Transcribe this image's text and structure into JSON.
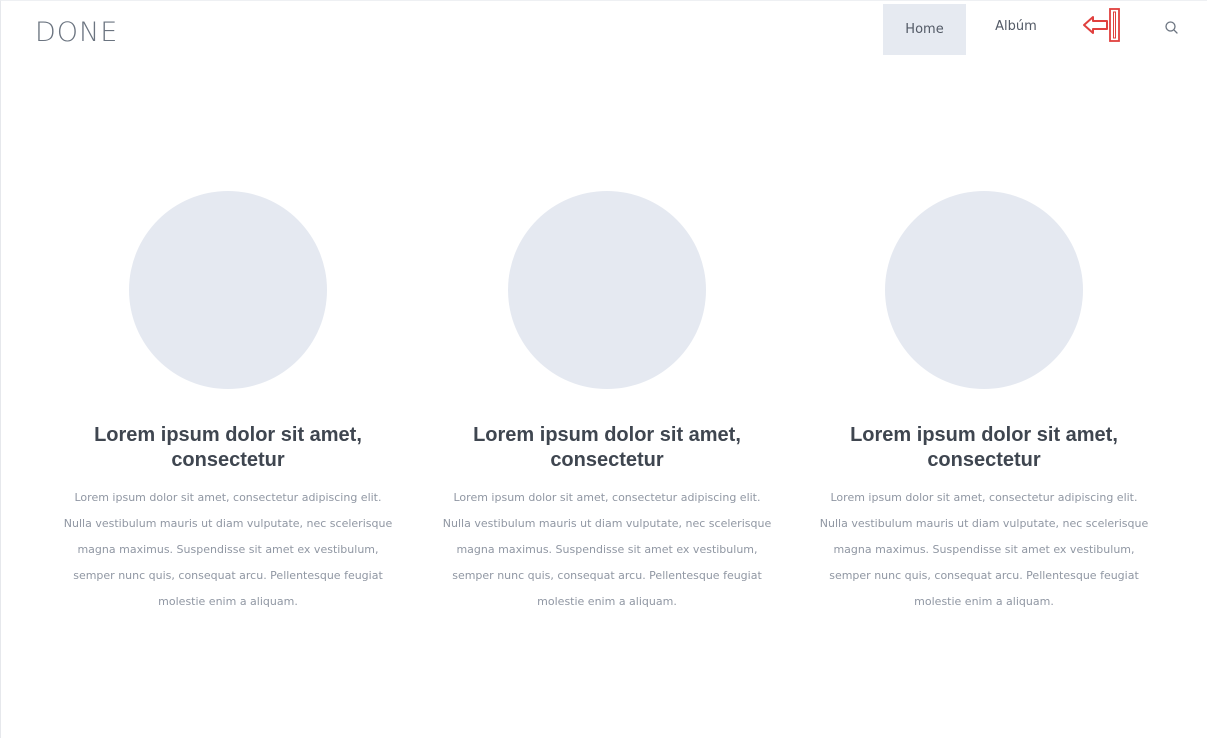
{
  "header": {
    "logo": "DONE",
    "nav": {
      "home": "Home",
      "album": "Albúm"
    },
    "icons": {
      "logout": "logout-arrow-icon",
      "search": "search-icon"
    },
    "colors": {
      "active_nav_bg": "#e6eaf1",
      "logout_icon": "#e0403e"
    }
  },
  "features": [
    {
      "title": "Lorem ipsum dolor sit amet, consectetur",
      "body": "Lorem ipsum dolor sit amet, consectetur adipiscing elit. Nulla vestibulum mauris ut diam vulputate, nec scelerisque magna maximus. Suspendisse sit amet ex vestibulum, semper nunc quis, consequat arcu. Pellentesque feugiat molestie enim a aliquam."
    },
    {
      "title": "Lorem ipsum dolor sit amet, consectetur",
      "body": "Lorem ipsum dolor sit amet, consectetur adipiscing elit. Nulla vestibulum mauris ut diam vulputate, nec scelerisque magna maximus. Suspendisse sit amet ex vestibulum, semper nunc quis, consequat arcu. Pellentesque feugiat molestie enim a aliquam."
    },
    {
      "title": "Lorem ipsum dolor sit amet, consectetur",
      "body": "Lorem ipsum dolor sit amet, consectetur adipiscing elit. Nulla vestibulum mauris ut diam vulputate, nec scelerisque magna maximus. Suspendisse sit amet ex vestibulum, semper nunc quis, consequat arcu. Pellentesque feugiat molestie enim a aliquam."
    }
  ]
}
